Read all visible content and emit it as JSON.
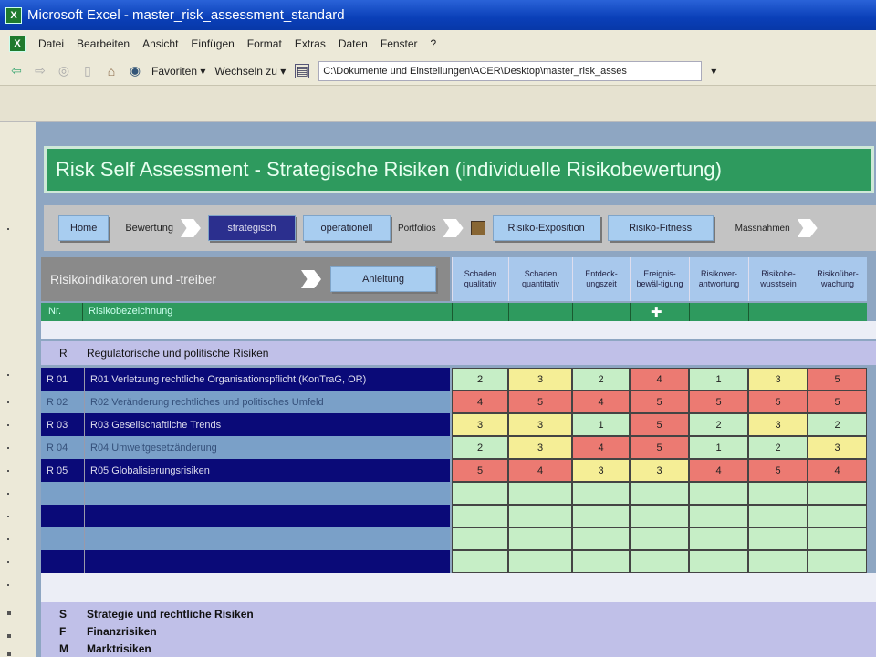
{
  "window": {
    "title": "Microsoft Excel - master_risk_assessment_standard",
    "app_icon": "X"
  },
  "menu": [
    "Datei",
    "Bearbeiten",
    "Ansicht",
    "Einfügen",
    "Format",
    "Extras",
    "Daten",
    "Fenster",
    "?"
  ],
  "toolbar": {
    "favorites": "Favoriten ▾",
    "goto": "Wechseln zu ▾",
    "address": "C:\\Dokumente und Einstellungen\\ACER\\Desktop\\master_risk_asses",
    "address_dropdown": "▾"
  },
  "banner": "Risk Self Assessment  - Strategische Risiken (individuelle Risikobewertung)",
  "nav": {
    "home": "Home",
    "bewertung": "Bewertung",
    "strategisch": "strategisch",
    "operationell": "operationell",
    "portfolios": "Portfolios",
    "exposition": "Risiko-Exposition",
    "fitness": "Risiko-Fitness",
    "massnahmen": "Massnahmen"
  },
  "header": {
    "left": "Risikoindikatoren und -treiber",
    "anleitung": "Anleitung",
    "nr": "Nr.",
    "bezeichnung": "Risikobezeichnung",
    "columns": [
      "Schaden qualitativ",
      "Schaden quantitativ",
      "Entdeck-ungszeit",
      "Ereignis-bewäl-tigung",
      "Risikover-antwortung",
      "Risikobe-wusstsein",
      "Risikoüber-wachung"
    ]
  },
  "colors": {
    "low": "#c6eec6",
    "mid": "#f5ee96",
    "high": "#ec7a72"
  },
  "section_r": {
    "code": "R",
    "name": "Regulatorische und politische Risiken"
  },
  "rows": [
    {
      "nr": "R 01",
      "name": "R01 Verletzung rechtliche Organisationspflicht (KonTraG, OR)",
      "values": [
        2,
        3,
        2,
        4,
        1,
        3,
        5
      ]
    },
    {
      "nr": "R 02",
      "name": "R02 Veränderung rechtliches und politisches Umfeld",
      "values": [
        4,
        5,
        4,
        5,
        5,
        5,
        5
      ]
    },
    {
      "nr": "R 03",
      "name": "R03 Gesellschaftliche Trends",
      "values": [
        3,
        3,
        1,
        5,
        2,
        3,
        2
      ]
    },
    {
      "nr": "R 04",
      "name": "R04 Umweltgesetzänderung",
      "values": [
        2,
        3,
        4,
        5,
        1,
        2,
        3
      ]
    },
    {
      "nr": "R 05",
      "name": "R05 Globalisierungsrisiken",
      "values": [
        5,
        4,
        3,
        3,
        4,
        5,
        4
      ]
    }
  ],
  "sections_below": [
    {
      "code": "S",
      "name": "Strategie und rechtliche Risiken"
    },
    {
      "code": "F",
      "name": "Finanzrisiken"
    },
    {
      "code": "M",
      "name": "Marktrisiken"
    }
  ]
}
